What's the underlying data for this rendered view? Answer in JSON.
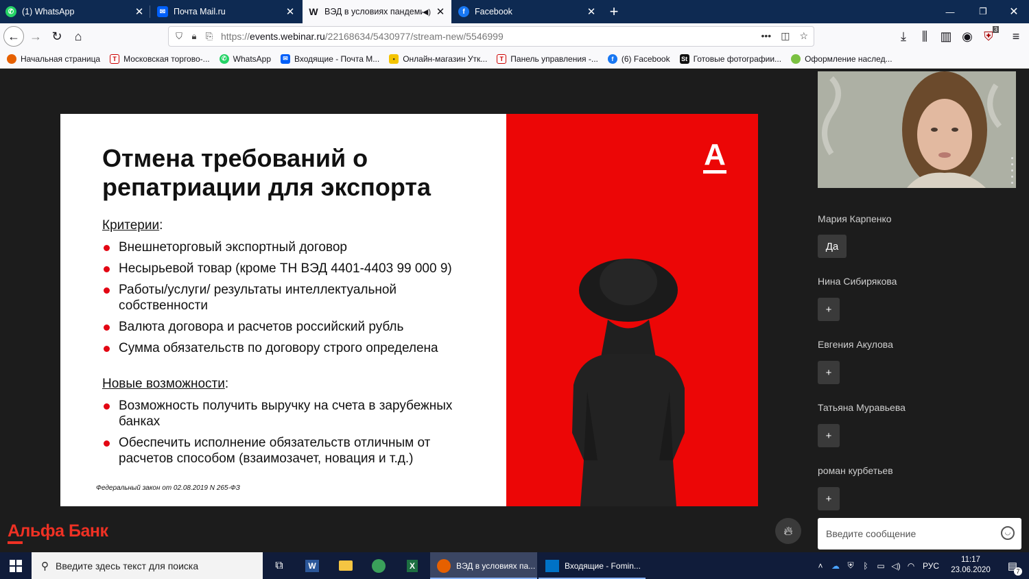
{
  "browser": {
    "tabs": [
      {
        "title": "(1) WhatsApp",
        "icon": "whatsapp-icon"
      },
      {
        "title": "Почта Mail.ru",
        "icon": "mail-icon"
      },
      {
        "title": "ВЭД в условиях пандеми",
        "icon": "webinar-icon",
        "favicon_text": "W",
        "active": true
      },
      {
        "title": "Facebook",
        "icon": "facebook-icon"
      }
    ],
    "url_domain": "events.webinar.ru",
    "url_prefix": "https://",
    "url_path": "/22168634/5430977/stream-new/5546999",
    "url_more": "•••",
    "addon_badge": "3",
    "bookmarks": [
      {
        "label": "Начальная страница",
        "color": "#e66000"
      },
      {
        "label": "Московская торгово-...",
        "color": "#c00"
      },
      {
        "label": "WhatsApp",
        "color": "#25d366"
      },
      {
        "label": "Входящие - Почта М...",
        "color": "#005ff9"
      },
      {
        "label": "Онлайн-магазин Утк...",
        "color": "#f4c400"
      },
      {
        "label": "Панель управления -...",
        "color": "#c00"
      },
      {
        "label": "(6) Facebook",
        "color": "#1877f2"
      },
      {
        "label": "Готовые фотографии...",
        "color": "#111"
      },
      {
        "label": "Оформление наслед...",
        "color": "#7bc142"
      }
    ]
  },
  "slide": {
    "title_line1": "Отмена требований о",
    "title_line2": "репатриации для экспорта",
    "criteria_label": "Критерии",
    "criteria": [
      "Внешнеторговый экспортный договор",
      "Несырьевой товар (кроме ТН ВЭД 4401-4403 99 000 9)",
      "Работы/услуги/ результаты интеллектуальной собственности",
      "Валюта договора и расчетов российский рубль",
      "Сумма обязательств по договору строго определена"
    ],
    "opportunities_label": "Новые возможности",
    "opportunities": [
      "Возможность получить выручку на счета в зарубежных банках",
      "Обеспечить исполнение обязательств отличным от расчетов способом (взаимозачет, новация и т.д.)"
    ],
    "footnote": "Федеральный закон от 02.08.2019 N 265-ФЗ",
    "logo_letter": "А"
  },
  "brand": "Альфа Банк",
  "participants": [
    {
      "name": "Мария Карпенко",
      "button": "Да"
    },
    {
      "name": "Нина Сибирякова",
      "button": "+"
    },
    {
      "name": "Евгения Акулова",
      "button": "+"
    },
    {
      "name": "Татьяна Муравьева",
      "button": "+"
    },
    {
      "name": "роман курбетьев",
      "button": "+"
    }
  ],
  "chat": {
    "placeholder": "Введите сообщение"
  },
  "taskbar": {
    "search_placeholder": "Введите здесь текст для поиска",
    "apps": [
      {
        "label": "ВЭД в условиях па...",
        "icon": "firefox-icon"
      },
      {
        "label": "Входящие - Fomin...",
        "icon": "outlook-icon"
      }
    ],
    "language": "РУС",
    "time": "11:17",
    "date": "23.06.2020",
    "notifications": "7"
  },
  "colors": {
    "alfa_red": "#ef3124",
    "slide_red": "#ec0606",
    "tab_bg": "#0e2a52",
    "taskbar_bg": "#101c3a"
  }
}
